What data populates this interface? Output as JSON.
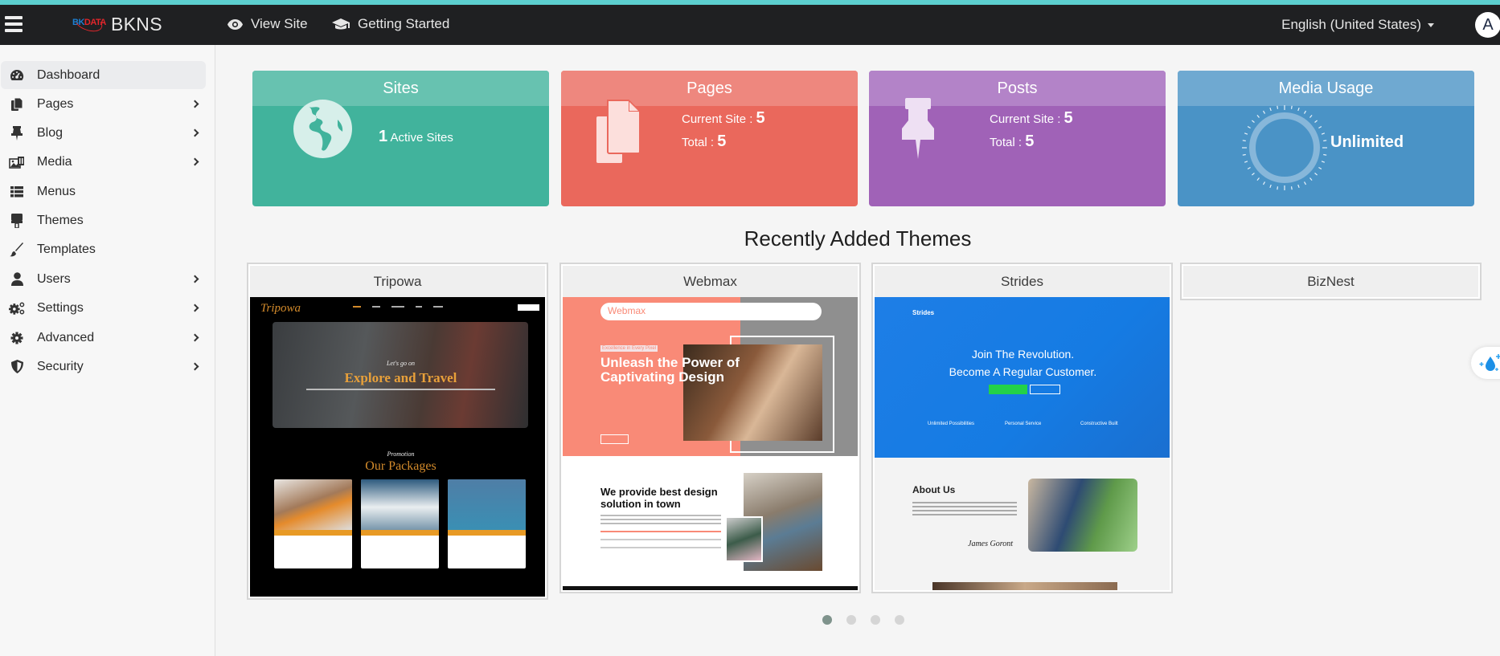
{
  "topbar": {
    "logo_mark_a": "BK",
    "logo_mark_b": "DATA",
    "brand": "BKNS",
    "view_site": "View Site",
    "getting_started": "Getting Started",
    "language": "English (United States)",
    "avatar_initial": "A"
  },
  "sidebar": {
    "items": [
      {
        "label": "Dashboard",
        "icon": "dashboard-icon",
        "active": true,
        "has_children": false
      },
      {
        "label": "Pages",
        "icon": "pages-icon",
        "has_children": true
      },
      {
        "label": "Blog",
        "icon": "pin-icon",
        "has_children": true
      },
      {
        "label": "Media",
        "icon": "media-icon",
        "has_children": true
      },
      {
        "label": "Menus",
        "icon": "list-icon",
        "has_children": false
      },
      {
        "label": "Themes",
        "icon": "paint-roller-icon",
        "has_children": false
      },
      {
        "label": "Templates",
        "icon": "brush-icon",
        "has_children": false
      },
      {
        "label": "Users",
        "icon": "user-icon",
        "has_children": true
      },
      {
        "label": "Settings",
        "icon": "cogs-icon",
        "has_children": true
      },
      {
        "label": "Advanced",
        "icon": "gear-icon",
        "has_children": true
      },
      {
        "label": "Security",
        "icon": "shield-icon",
        "has_children": true
      }
    ]
  },
  "stats": {
    "sites": {
      "title": "Sites",
      "count": "1",
      "label": "Active Sites",
      "color": "#41b39c"
    },
    "pages": {
      "title": "Pages",
      "current_label": "Current Site :",
      "current": "5",
      "total_label": "Total :",
      "total": "5",
      "color": "#ea685c"
    },
    "posts": {
      "title": "Posts",
      "current_label": "Current Site :",
      "current": "5",
      "total_label": "Total :",
      "total": "5",
      "color": "#a062b7"
    },
    "media": {
      "title": "Media Usage",
      "value": "Unlimited",
      "color": "#4a93c6"
    }
  },
  "themes": {
    "title": "Recently Added Themes",
    "items": [
      {
        "name": "Tripowa",
        "preview": {
          "brand": "Tripowa",
          "tagline": "Let's go on",
          "headline": "Explore and Travel",
          "section_kicker": "Promotion",
          "section_title": "Our Packages"
        }
      },
      {
        "name": "Webmax",
        "preview": {
          "brand": "Webmax",
          "kicker": "Excellence in Every Pixel",
          "headline": "Unleash the Power of Captivating Design",
          "section_title": "We provide best design solution in town"
        }
      },
      {
        "name": "Strides",
        "preview": {
          "brand": "Strides",
          "headline_1": "Join The Revolution.",
          "headline_2": "Become A Regular Customer.",
          "features": [
            "Unlimited Possibilities",
            "Personal Service",
            "Constructive Built"
          ],
          "about_title": "About Us",
          "signature": "James Goront"
        }
      },
      {
        "name": "BizNest",
        "preview": null
      }
    ]
  },
  "carousel": {
    "pages": 4,
    "active": 1
  }
}
